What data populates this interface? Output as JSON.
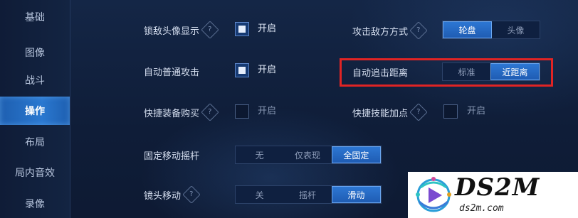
{
  "sidebar": {
    "items": [
      {
        "label": "基础",
        "active": false
      },
      {
        "label": "图像",
        "active": false
      },
      {
        "label": "战斗",
        "active": false
      },
      {
        "label": "操作",
        "active": true
      },
      {
        "label": "布局",
        "active": false
      },
      {
        "label": "局内音效",
        "active": false
      },
      {
        "label": "录像",
        "active": false
      }
    ]
  },
  "settings": {
    "lock_enemy_avatar": {
      "label": "锁敌头像显示",
      "help": "?",
      "state": "开启"
    },
    "auto_basic_attack": {
      "label": "自动普通攻击",
      "state": "开启"
    },
    "quick_buy_equipment": {
      "label": "快捷装备购买",
      "help": "?",
      "state": "开启"
    },
    "fixed_joystick": {
      "label": "固定移动摇杆",
      "options": [
        "无",
        "仅表现",
        "全固定"
      ],
      "selected": "全固定"
    },
    "camera_move": {
      "label": "镜头移动",
      "help": "?",
      "options": [
        "关",
        "摇杆",
        "滑动"
      ],
      "selected": "滑动"
    },
    "attack_target_mode": {
      "label": "攻击敌方方式",
      "help": "?",
      "options": [
        "轮盘",
        "头像"
      ],
      "selected": "轮盘"
    },
    "auto_chase_distance": {
      "label": "自动追击距离",
      "options": [
        "标准",
        "近距离"
      ],
      "selected": "近距离"
    },
    "quick_skill_upgrade": {
      "label": "快捷技能加点",
      "help": "?",
      "state": "开启"
    }
  },
  "watermark": {
    "logo": "DS2M",
    "url": "ds2m.com"
  },
  "colors": {
    "accent": "#2d77d3",
    "highlight_border": "#e02424",
    "background": "#101f3b"
  }
}
